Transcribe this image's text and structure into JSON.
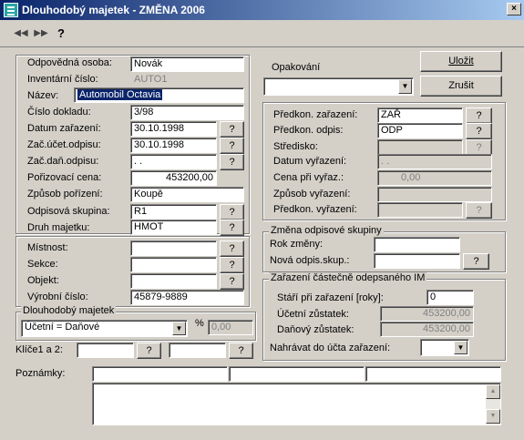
{
  "window": {
    "title": "Dlouhodobý majetek - ZMĚNA 2006",
    "close": "×"
  },
  "toolbar": {
    "first": "◀◀",
    "next": "▶▶",
    "help": "?"
  },
  "left": {
    "odpovedna_label": "Odpovědná osoba:",
    "odpovedna_value": "Novák",
    "inventarni_label": "Inventární číslo:",
    "inventarni_value": "AUTO1",
    "nazev_label": "Název:",
    "nazev_value": "Automobil Octavia",
    "cislo_label": "Číslo dokladu:",
    "cislo_value": "3/98",
    "datum_label": "Datum zařazení:",
    "datum_value": "30.10.1998",
    "zacucet_label": "Zač.účet.odpisu:",
    "zacucet_value": "30.10.1998",
    "zacdan_label": "Zač.daň.odpisu:",
    "zacdan_value": " . .",
    "porizovaci_label": "Pořizovací cena:",
    "porizovaci_value": "453200,00",
    "zpusob_label": "Způsob pořízení:",
    "zpusob_value": "Koupě",
    "odpisova_label": "Odpisová skupina:",
    "odpisova_value": "R1",
    "druh_label": "Druh majetku:",
    "druh_value": "HMOT",
    "mistnost_label": "Místnost:",
    "mistnost_value": "",
    "sekce_label": "Sekce:",
    "sekce_value": "",
    "objekt_label": "Objekt:",
    "objekt_value": "",
    "vyrobni_label": "Výrobní číslo:",
    "vyrobni_value": "45879-9889",
    "dm_group": "Dlouhodobý majetek",
    "dm_select": "Účetní = Daňové",
    "pct_symbol": "%",
    "pct_value": "0,00",
    "klic_label": "Klíče1 a 2:",
    "klic1": "",
    "klic2": "",
    "q": "?"
  },
  "right": {
    "opakovani_label": "Opakování",
    "opakovani_value": "",
    "ulozit": "Uložit",
    "zrusit": "Zrušit",
    "predkon_zar_label": "Předkon. zařazení:",
    "predkon_zar_value": "ZAŘ",
    "predkon_odp_label": "Předkon. odpis:",
    "predkon_odp_value": "ODP",
    "stredisko_label": "Středisko:",
    "stredisko_value": "",
    "datum_vyr_label": "Datum vyřazení:",
    "datum_vyr_value": " . .",
    "cena_vyr_label": "Cena při vyřaz.:",
    "cena_vyr_value": "0,00",
    "zpusob_vyr_label": "Způsob vyřazení:",
    "zpusob_vyr_value": "",
    "predkon_vyr_label": "Předkon. vyřazení:",
    "predkon_vyr_value": "",
    "zmena_group": "Změna odpisové skupiny",
    "rok_label": "Rok změny:",
    "rok_value": "",
    "nova_label": "Nová odpis.skup.:",
    "nova_value": "",
    "zarazeni_group": "Zařazení částečně odepsaného IM",
    "stari_label": "Stáří při zařazení [roky]:",
    "stari_value": "0",
    "ucetni_label": "Účetní zůstatek:",
    "ucetni_value": "453200,00",
    "danovy_label": "Daňový zůstatek:",
    "danovy_value": "453200,00",
    "nahravat_label": "Nahrávat do účta zařazení:",
    "nahravat_value": ""
  },
  "notes": {
    "label": "Poznámky:",
    "f1": "",
    "f2": "",
    "f3": "",
    "body": ""
  }
}
